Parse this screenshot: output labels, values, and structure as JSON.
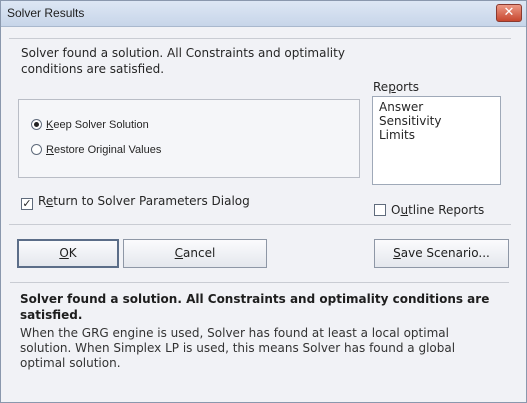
{
  "window": {
    "title": "Solver Results",
    "close_glyph": "✕"
  },
  "message": "Solver found a solution.  All Constraints and optimality conditions are satisfied.",
  "reports": {
    "label_pre": "Re",
    "label_key": "p",
    "label_post": "orts",
    "items": [
      "Answer",
      "Sensitivity",
      "Limits"
    ]
  },
  "options": {
    "keep": {
      "key": "K",
      "rest": "eep Solver Solution",
      "selected": true
    },
    "restore": {
      "key": "R",
      "rest": "estore Original Values",
      "selected": false
    }
  },
  "return_to_params": {
    "pre": "R",
    "key": "e",
    "post": "turn to Solver Parameters Dialog",
    "checked": true
  },
  "outline_reports": {
    "pre": "O",
    "key": "u",
    "post": "tline Reports",
    "checked": false
  },
  "buttons": {
    "ok": {
      "key": "O",
      "rest": "K"
    },
    "cancel": {
      "key": "C",
      "rest": "ancel"
    },
    "save_scenario": {
      "key": "S",
      "rest": "ave Scenario..."
    }
  },
  "summary": {
    "headline": "Solver found a solution.  All Constraints and optimality conditions are satisfied.",
    "detail": "When the GRG engine is used, Solver has found at least a local optimal solution. When Simplex LP is used, this means Solver has found a global optimal solution."
  }
}
